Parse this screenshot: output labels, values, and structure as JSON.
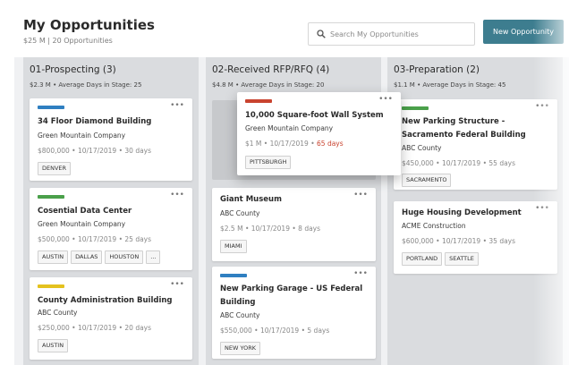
{
  "header": {
    "title": "My Opportunities",
    "subtitle": "$25 M  |  20 Opportunities",
    "search_placeholder": "Search My Opportunities",
    "new_button": "New Opportunity"
  },
  "columns": [
    {
      "title": "01-Prospecting (3)",
      "summary": "$2.3 M  •  Average Days in Stage: 25",
      "cards": [
        {
          "color": "#2f7fc1",
          "name": "34 Floor Diamond Building",
          "company": "Green Mountain Company",
          "meta": "$800,000  •  10/17/2019  •  30 days",
          "tags": [
            "DENVER"
          ]
        },
        {
          "color": "#4aa04a",
          "name": "Cosential Data Center",
          "company": "Green Mountain Company",
          "meta": "$500,000  •  10/17/2019  •  25 days",
          "tags": [
            "AUSTIN",
            "DALLAS",
            "HOUSTON",
            "..."
          ]
        },
        {
          "color": "#e4c21e",
          "name": "County Administration Building",
          "company": "ABC County",
          "meta": "$250,000  •  10/17/2019  •  20 days",
          "tags": [
            "AUSTIN"
          ]
        }
      ]
    },
    {
      "title": "02-Received RFP/RFQ (4)",
      "summary": "$4.8 M  •  Average Days in Stage: 20",
      "cards": [
        {
          "color": "#c9432f",
          "name": "10,000 Square-foot Wall System",
          "company": "Green Mountain Company",
          "meta_prefix": "$1 M  •  10/17/2019  •  ",
          "meta_late": "65 days",
          "tags": [
            "PITTSBURGH"
          ]
        },
        {
          "name": "Giant Museum",
          "company": "ABC County",
          "meta": "$2.5 M  •  10/17/2019  •  8 days",
          "tags": [
            "MIAMI"
          ]
        },
        {
          "color": "#2f7fc1",
          "name_line1": "New Parking Garage - US Federal",
          "name_line2": "Building",
          "company": "ABC County",
          "meta": "$550,000  •  10/17/2019  •  5 days",
          "tags": [
            "NEW YORK"
          ]
        }
      ]
    },
    {
      "title": "03-Preparation (2)",
      "summary": "$1.1 M  •  Average Days in Stage: 45",
      "cards": [
        {
          "color": "#4aa04a",
          "name_line1": "New Parking Structure -",
          "name_line2": "Sacramento Federal Building",
          "company": "ABC County",
          "meta": "$450,000  •  10/17/2019  •  55 days",
          "tags": [
            "SACRAMENTO"
          ]
        },
        {
          "name": "Huge Housing Development",
          "company": "ACME Construction",
          "meta": "$600,000  •  10/17/2019  •  35 days",
          "tags": [
            "PORTLAND",
            "SEATTLE"
          ]
        }
      ]
    }
  ],
  "icons": {
    "search": "search-icon",
    "more": "more-options-icon"
  },
  "colors": {
    "accent": "#3d7d8f",
    "late": "#c9432f"
  }
}
